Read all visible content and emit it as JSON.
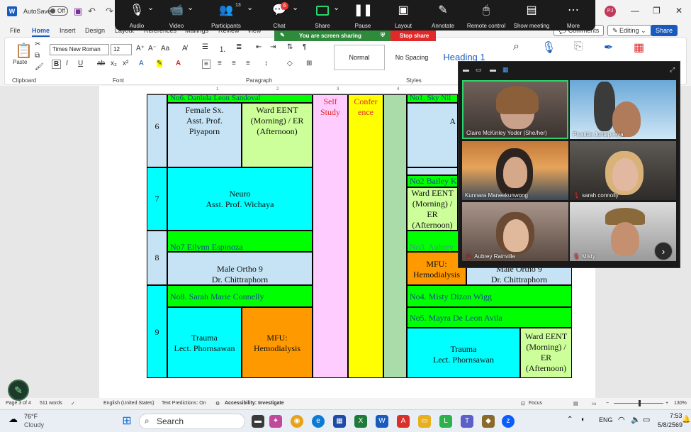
{
  "word": {
    "autosave_label": "AutoSave",
    "autosave_state": "Off",
    "user_initials": "PJ",
    "tabs": [
      "File",
      "Home",
      "Insert",
      "Design",
      "Layout",
      "References",
      "Mailings",
      "Review",
      "View"
    ],
    "comments_label": "Comments",
    "editing_label": "Editing",
    "share_label": "Share",
    "ribbon": {
      "paste_label": "Paste",
      "clipboard_label": "Clipboard",
      "font_name": "Times New Roman",
      "font_size": "12",
      "font_label": "Font",
      "paragraph_label": "Paragraph",
      "styles_label": "Styles",
      "styles": [
        "Normal",
        "No Spacing",
        "Heading 1"
      ],
      "find_label": "Editing",
      "dictate_label": "Dictate",
      "sensitivity_label": "Sensitivity",
      "editor_label": "Editor",
      "addins_label": "Add-ins"
    },
    "status": {
      "page": "Page 3 of 4",
      "words": "511 words",
      "language": "English (United States)",
      "predictions": "Text Predictions: On",
      "accessibility": "Accessibility: Investigate",
      "focus": "Focus",
      "zoom": "130%"
    }
  },
  "zoom_toolbar": {
    "items": [
      {
        "label": "Audio",
        "icon": "microphone-icon"
      },
      {
        "label": "Video",
        "icon": "video-camera-icon"
      },
      {
        "label": "Participants",
        "icon": "participants-icon",
        "count": "13"
      },
      {
        "label": "Chat",
        "icon": "chat-icon",
        "badge": "6"
      },
      {
        "label": "Share",
        "icon": "share-screen-icon"
      },
      {
        "label": "Pause",
        "icon": "pause-icon"
      },
      {
        "label": "Layout",
        "icon": "layout-icon"
      },
      {
        "label": "Annotate",
        "icon": "pen-icon"
      },
      {
        "label": "Remote control",
        "icon": "mouse-icon"
      },
      {
        "label": "Show meeting",
        "icon": "show-meeting-icon"
      },
      {
        "label": "More",
        "icon": "more-icon"
      }
    ],
    "sharing_message": "You are screen sharing",
    "stop_share_label": "Stop share"
  },
  "document": {
    "ruler_marks": [
      "1",
      "2",
      "3",
      "4"
    ],
    "table": {
      "row6": {
        "num": "6",
        "header": "No6. Daniela Leon Sandoval",
        "cell1": "Female Sx.\nAsst. Prof.\nPiyaporn",
        "cell2": "Ward EENT\n(Morning) / ER\n(Afternoon)",
        "right_header": "No1. Sky Nil",
        "right_letter": "A"
      },
      "self_study": "Self\nStudy",
      "conference": "Confer\nence",
      "row7": {
        "num": "7",
        "cell": "Neuro\nAsst. Prof. Wichaya",
        "right_header": "No2 Bailey K",
        "right_cell": "Ward EENT\n(Morning) /\nER\n(Afternoon)"
      },
      "row8": {
        "num": "8",
        "header": "No7 Eilynn Espinoza",
        "cell": "Male Ortho 9\nDr. Chittraphorn",
        "right_header": "No3. Aubrey",
        "right_cell1": "MFU:\nHemodialysis",
        "right_cell2": "Male Ortho 9\nDr. Chittraphorn"
      },
      "row9": {
        "num": "9",
        "header": "No8. Sarah Marie Connelly",
        "cell1": "Trauma\nLect. Phornsawan",
        "cell2": "MFU:\nHemodialysis",
        "right_header1": "No4. Misty Dizon Wigg",
        "right_header2": "No5. Mayra De Leon Avila",
        "right_cell1": "Trauma\nLect. Phornsawan",
        "right_cell2": "Ward EENT\n(Morning) /\nER\n(Afternoon)"
      }
    }
  },
  "gallery": {
    "participants": [
      {
        "name": "Claire McKinley Yoder (She/her)",
        "muted": false
      },
      {
        "name": "Piyatida Junlapeeya",
        "muted": false
      },
      {
        "name": "Kunnara Maneekunwong",
        "muted": false
      },
      {
        "name": "sarah connolly",
        "muted": true
      },
      {
        "name": "Aubrey Rainville",
        "muted": true
      },
      {
        "name": "Misty",
        "muted": true
      }
    ]
  },
  "taskbar": {
    "weather_temp": "76°F",
    "weather_desc": "Cloudy",
    "search_label": "Search",
    "language": "ENG",
    "time": "7:53",
    "date": "5/8/2569"
  },
  "colors": {
    "green_header": "#00ff00",
    "cyan": "#00ffff",
    "light_green": "#ccff99",
    "light_blue": "#c5e3f4",
    "orange": "#ff9900",
    "yellow": "#ffff00",
    "pink": "#ffccff",
    "sage": "#a9dca9"
  }
}
